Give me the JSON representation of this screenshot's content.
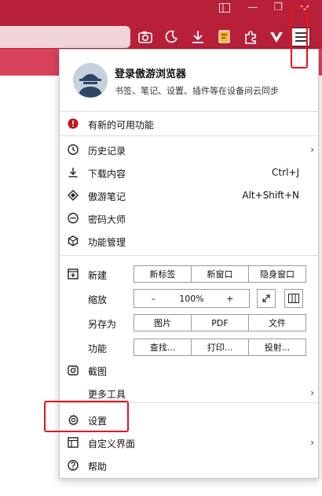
{
  "window": {
    "minimize_glyph": "—",
    "restore_glyph": "❐",
    "close_glyph": "✕"
  },
  "toolbar_icons": [
    "screenshot-icon",
    "night-mode-icon",
    "download-icon",
    "notes-icon",
    "extensions-icon",
    "vivaldi-icon",
    "menu-icon"
  ],
  "menu": {
    "profile": {
      "title": "登录傲游浏览器",
      "subtitle": "书签、笔记、设置、插件等在设备间云同步"
    },
    "update": {
      "label": "有新的可用功能",
      "icon": "alert-icon"
    },
    "history": {
      "label": "历史记录",
      "icon": "clock-icon"
    },
    "downloads": {
      "label": "下载内容",
      "shortcut": "Ctrl+J",
      "icon": "download-icon"
    },
    "notes": {
      "label": "傲游笔记",
      "shortcut": "Alt+Shift+N",
      "icon": "notes-icon"
    },
    "passwords": {
      "label": "密码大师",
      "icon": "key-icon"
    },
    "features": {
      "label": "功能管理",
      "icon": "cube-icon"
    },
    "new": {
      "label": "新建",
      "options": [
        "新标签",
        "新窗口",
        "隐身窗口"
      ]
    },
    "zoom": {
      "label": "缩放",
      "minus": "–",
      "value": "100%",
      "plus": "+"
    },
    "save_as": {
      "label": "另存为",
      "options": [
        "图片",
        "PDF",
        "文件"
      ]
    },
    "functions": {
      "label": "功能",
      "options": [
        "查找...",
        "打印...",
        "投射..."
      ]
    },
    "screenshot": {
      "label": "截图",
      "icon": "camera-icon"
    },
    "more_tools": {
      "label": "更多工具"
    },
    "settings": {
      "label": "设置",
      "icon": "gear-icon"
    },
    "customize": {
      "label": "自定义界面",
      "icon": "layout-icon"
    },
    "help": {
      "label": "帮助",
      "icon": "help-icon"
    }
  },
  "colors": {
    "chrome_dark": "#b8203a",
    "tabstrip": "#d9415a",
    "annotation": "#e8111b",
    "alert": "#c0141e"
  }
}
